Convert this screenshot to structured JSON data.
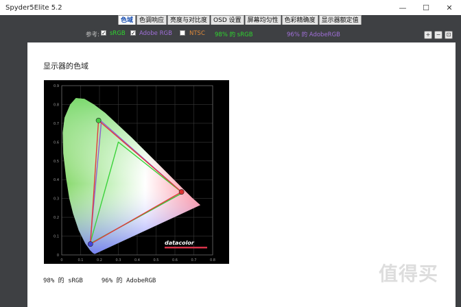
{
  "window": {
    "title": "Spyder5Elite 5.2",
    "controls": [
      "—",
      "☐",
      "✕"
    ]
  },
  "tabs": [
    {
      "label": "色域",
      "active": true
    },
    {
      "label": "色调响应",
      "active": false
    },
    {
      "label": "亮度与对比度",
      "active": false
    },
    {
      "label": "OSD 设置",
      "active": false
    },
    {
      "label": "屏幕均匀性",
      "active": false
    },
    {
      "label": "色彩精确度",
      "active": false
    },
    {
      "label": "显示器额定值",
      "active": false
    }
  ],
  "reference": {
    "label": "参考:",
    "options": [
      {
        "label": "sRGB",
        "checked": true,
        "color": "#2fd62f"
      },
      {
        "label": "Adobe RGB",
        "checked": true,
        "color": "#a06fd8"
      },
      {
        "label": "NTSC",
        "checked": false,
        "color": "#e08a3a"
      }
    ],
    "result_srgb": "98% 的 sRGB",
    "result_srgb_color": "#2fd62f",
    "result_adobe": "96% 的 AdobeRGB",
    "result_adobe_color": "#a06fd8"
  },
  "zoom_icons": [
    "zoom-in-icon",
    "zoom-out-icon",
    "zoom-fit-icon"
  ],
  "panel": {
    "heading": "显示器的色域",
    "summary": "98% 的 sRGB     96% 的 AdobeRGB"
  },
  "chart_data": {
    "type": "scatter",
    "x_ticks": [
      "0",
      "0.1",
      "0.2",
      "0.3",
      "0.4",
      "0.5",
      "0.6",
      "0.7",
      "0.8"
    ],
    "y_ticks": [
      "0",
      "0.1",
      "0.2",
      "0.3",
      "0.4",
      "0.5",
      "0.6",
      "0.7",
      "0.8",
      "0.9"
    ],
    "xlim": [
      0,
      0.8
    ],
    "ylim": [
      0,
      0.9
    ],
    "grid": true,
    "locus": [
      [
        0.175,
        0.005
      ],
      [
        0.165,
        0.01
      ],
      [
        0.15,
        0.025
      ],
      [
        0.125,
        0.06
      ],
      [
        0.09,
        0.13
      ],
      [
        0.06,
        0.22
      ],
      [
        0.04,
        0.3
      ],
      [
        0.023,
        0.41
      ],
      [
        0.008,
        0.54
      ],
      [
        0.005,
        0.65
      ],
      [
        0.015,
        0.73
      ],
      [
        0.045,
        0.8
      ],
      [
        0.075,
        0.834
      ],
      [
        0.12,
        0.83
      ],
      [
        0.17,
        0.8
      ],
      [
        0.23,
        0.755
      ],
      [
        0.3,
        0.69
      ],
      [
        0.37,
        0.625
      ],
      [
        0.44,
        0.555
      ],
      [
        0.51,
        0.485
      ],
      [
        0.58,
        0.415
      ],
      [
        0.64,
        0.355
      ],
      [
        0.69,
        0.305
      ],
      [
        0.735,
        0.265
      ]
    ],
    "srgb": [
      [
        0.64,
        0.33
      ],
      [
        0.3,
        0.6
      ],
      [
        0.15,
        0.06
      ]
    ],
    "adobe_rgb": [
      [
        0.64,
        0.33
      ],
      [
        0.21,
        0.71
      ],
      [
        0.15,
        0.06
      ]
    ],
    "display": [
      [
        0.635,
        0.335
      ],
      [
        0.195,
        0.715
      ],
      [
        0.152,
        0.058
      ]
    ],
    "colors": {
      "srgb": "#3ad23a",
      "adobe_rgb": "#8c5fd0",
      "display": "#e23a3a"
    },
    "brand": "datacolor"
  }
}
